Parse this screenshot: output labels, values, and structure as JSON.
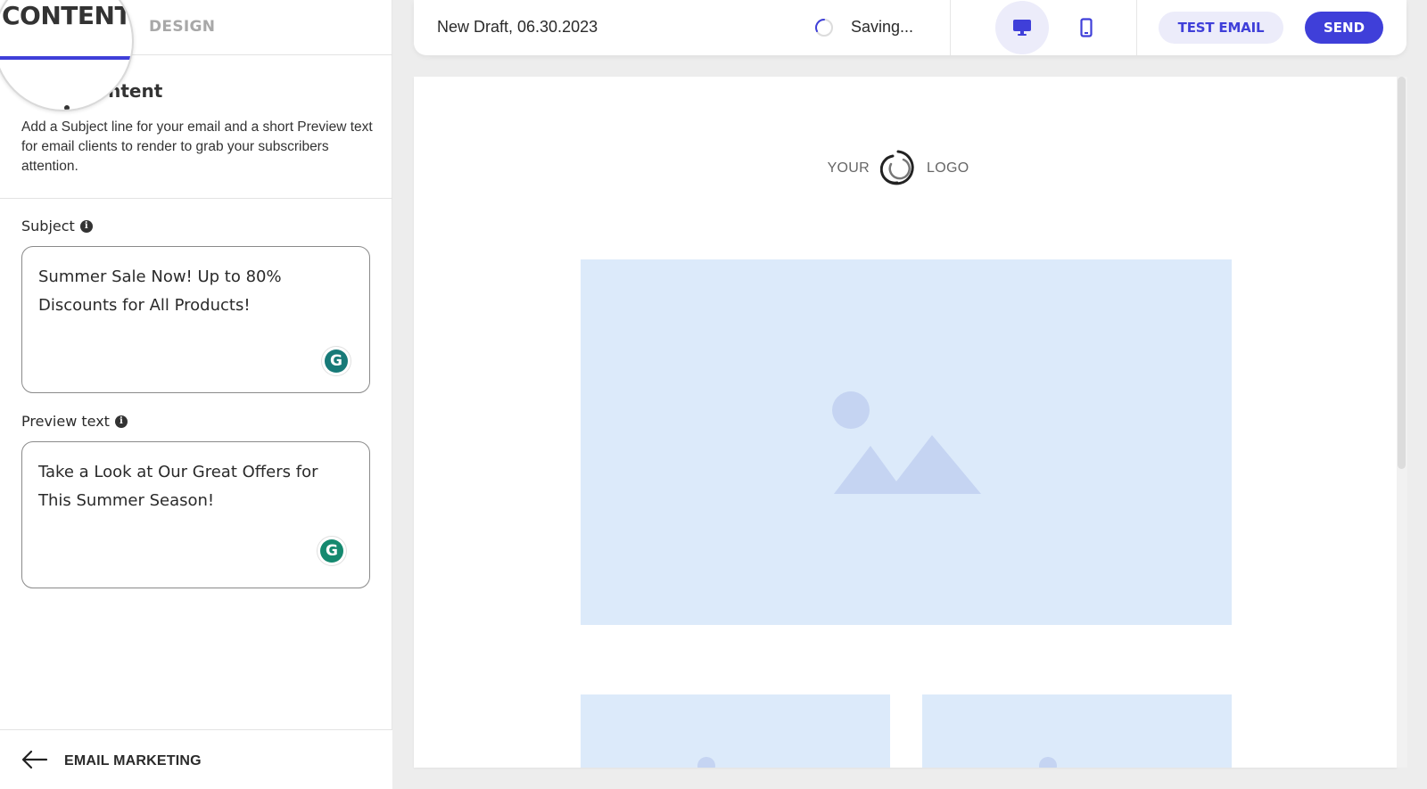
{
  "tabs": [
    {
      "label": "CONTENT",
      "active": true
    },
    {
      "label": "DESIGN",
      "active": false
    }
  ],
  "magnifier": {
    "text": "CONTENT"
  },
  "section": {
    "heading": "Email Content",
    "heading_visible": "ntent",
    "description": "Add a Subject line for your email and a short Preview text for email clients to render to grab your subscribers attention."
  },
  "subject": {
    "label": "Subject",
    "value": "Summer Sale Now! Up to 80% Discounts for All Products!"
  },
  "preview_text": {
    "label": "Preview text",
    "value": "Take a Look at Our Great Offers for This Summer Season!"
  },
  "icons": {
    "info": "i",
    "grammarly": "G"
  },
  "footer": {
    "back_label": "EMAIL MARKETING"
  },
  "toolbar": {
    "draft_title": "New Draft, 06.30.2023",
    "status": "Saving...",
    "view_mode": "desktop",
    "test_email_label": "TEST EMAIL",
    "send_label": "SEND"
  },
  "preview": {
    "logo_left": "YOUR",
    "logo_right": "LOGO"
  },
  "colors": {
    "accent": "#3f3fd9",
    "accent_soft": "#ececfa",
    "placeholder_bg": "#dceafa",
    "placeholder_shape": "#c5d4f2",
    "grammarly": "#15896f"
  }
}
